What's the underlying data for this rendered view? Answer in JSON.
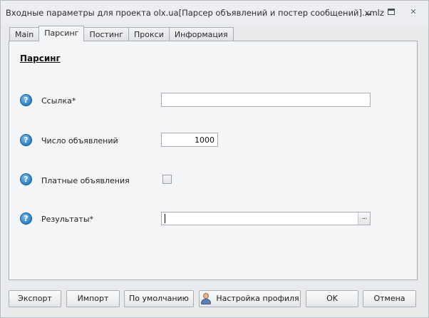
{
  "window": {
    "title": "Входные параметры для проекта olx.ua[Парсер объявлений и постер сообщений].xmlz"
  },
  "tabs": [
    {
      "label": "Main",
      "active": false
    },
    {
      "label": "Парсинг",
      "active": true
    },
    {
      "label": "Постинг",
      "active": false
    },
    {
      "label": "Прокси",
      "active": false
    },
    {
      "label": "Информация",
      "active": false
    }
  ],
  "section": {
    "title": "Парсинг"
  },
  "fields": {
    "link": {
      "label": "Ссылка*",
      "value": ""
    },
    "count": {
      "label": "Число объявлений",
      "value": "1000"
    },
    "paid": {
      "label": "Платные объявления",
      "checked": false
    },
    "results": {
      "label": "Результаты*",
      "value": "",
      "browse_label": "..."
    }
  },
  "help_icon": {
    "glyph": "?",
    "name": "help-icon"
  },
  "buttons": {
    "export": "Экспорт",
    "import": "Импорт",
    "defaults": "По умолчанию",
    "profile": "Настройка профиля",
    "ok": "OK",
    "cancel": "Отмена"
  }
}
